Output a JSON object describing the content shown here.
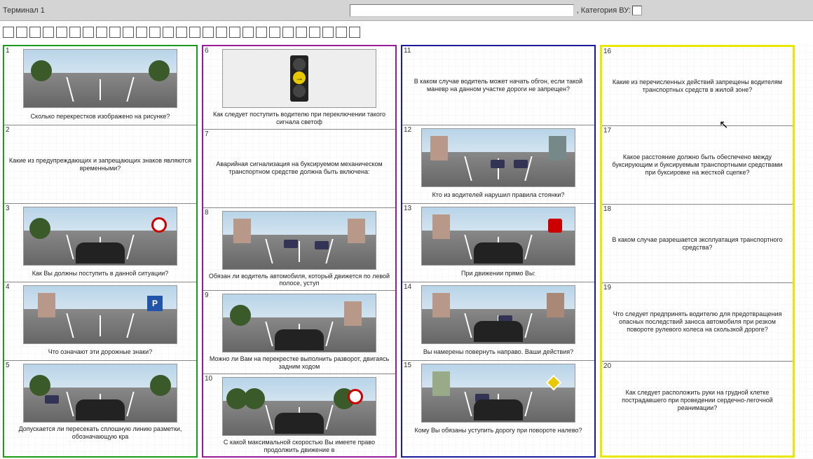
{
  "header": {
    "terminal": "Терминал 1",
    "category_label": ", Категория ВУ:"
  },
  "progress_count": 27,
  "columns": [
    {
      "cls": "col1",
      "cells": [
        {
          "n": "1",
          "img": "intersection",
          "q": "Сколько перекрестков изображено на рисунке?"
        },
        {
          "n": "2",
          "img": null,
          "q": "Какие из предупреждающих и запрещающих знаков являются временными?"
        },
        {
          "n": "3",
          "img": "road-sign-red",
          "q": "Как Вы должны поступить в данной ситуации?"
        },
        {
          "n": "4",
          "img": "road-park",
          "q": "Что означают эти дорожные знаки?"
        },
        {
          "n": "5",
          "img": "road-car-left",
          "q": "Допускается ли пересекать сплошную линию разметки, обозначающую кра"
        }
      ]
    },
    {
      "cls": "col2",
      "cells": [
        {
          "n": "6",
          "img": "traffic-light",
          "q": "Как следует поступить водителю при переключении такого сигнала светоф"
        },
        {
          "n": "7",
          "img": null,
          "q": "Аварийная сигнализация на буксируемом механическом транспортном средстве должна быть включена:"
        },
        {
          "n": "8",
          "img": "city-road",
          "q": "Обязан ли водитель автомобиля, который движется по левой полосе, уступ"
        },
        {
          "n": "9",
          "img": "intersection2",
          "q": "Можно ли Вам на перекрестке выполнить разворот, двигаясь задним ходом"
        },
        {
          "n": "10",
          "img": "forest-road",
          "q": "С какой максимальной скоростью Вы имеете право продолжить движение в"
        }
      ]
    },
    {
      "cls": "col3",
      "cells": [
        {
          "n": "11",
          "img": null,
          "q": "В каком случае водитель может начать обгон, если такой маневр на данном участке дороги не запрещен?"
        },
        {
          "n": "12",
          "img": "city-cars",
          "q": "Кто из водителей нарушил правила стоянки?"
        },
        {
          "n": "13",
          "img": "stop-sign",
          "q": "При движении прямо Вы:"
        },
        {
          "n": "14",
          "img": "city-turn",
          "q": "Вы намерены повернуть направо. Ваши действия?"
        },
        {
          "n": "15",
          "img": "diamond-sign",
          "q": "Кому Вы обязаны уступить дорогу при повороте налево?"
        }
      ]
    },
    {
      "cls": "col4",
      "cells": [
        {
          "n": "16",
          "img": null,
          "q": "Какие из перечисленных действий запрещены водителям транспортных средств в жилой зоне?"
        },
        {
          "n": "17",
          "img": null,
          "q": "Какое расстояние должно быть обеспечено между буксирующим и буксируемым транспортными средствами при буксировке на жесткой сцепке?"
        },
        {
          "n": "18",
          "img": null,
          "q": "В каком случае разрешается эксплуатация транспортного средства?"
        },
        {
          "n": "19",
          "img": null,
          "q": "Что следует предпринять водителю для предотвращения опасных последствий заноса автомобиля при резком повороте рулевого колеса на скользкой дороге?"
        },
        {
          "n": "20",
          "img": null,
          "q": "Как следует расположить руки на грудной клетке пострадавшего при проведении сердечно-легочной реанимации?"
        }
      ]
    }
  ]
}
